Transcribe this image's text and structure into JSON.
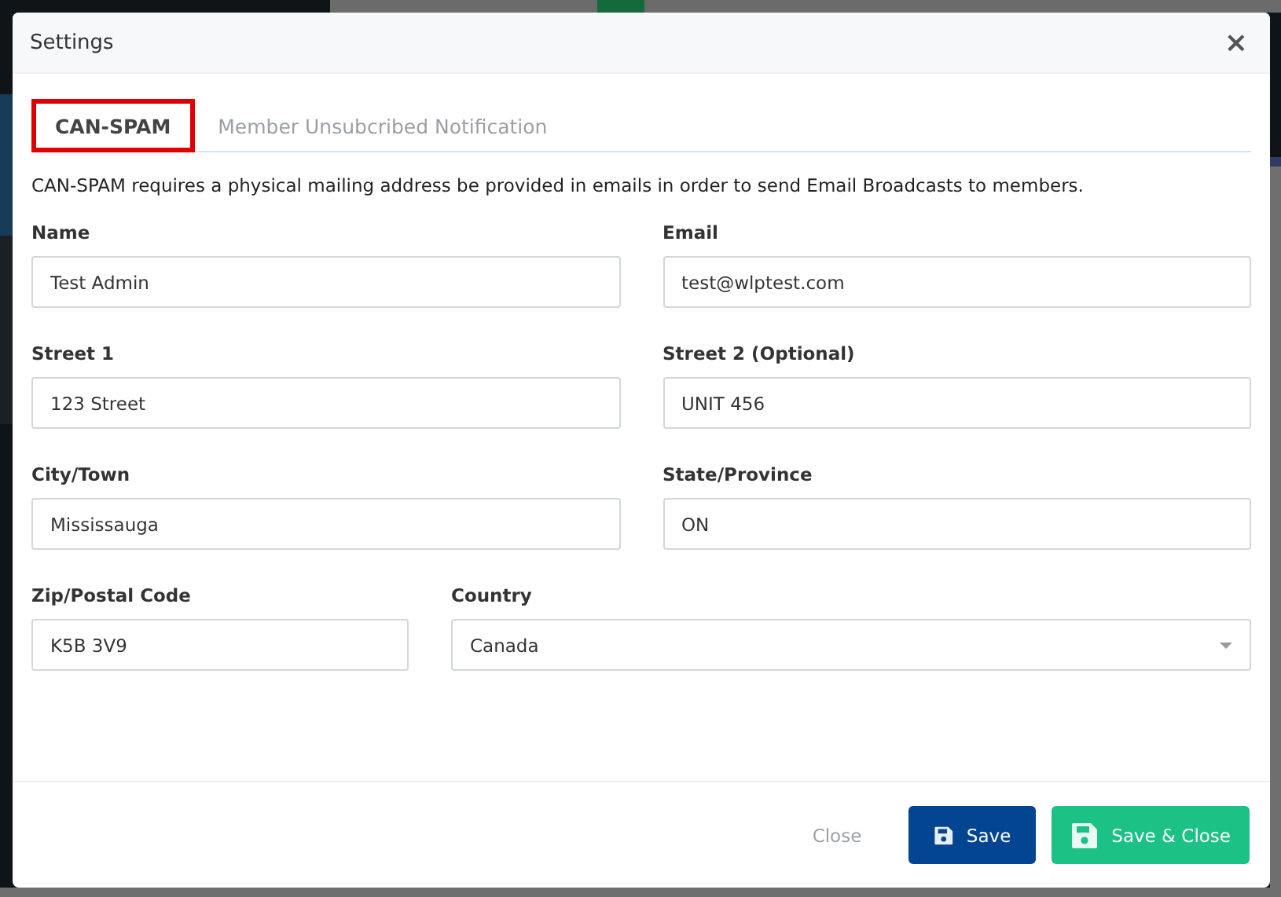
{
  "dialog": {
    "title": "Settings",
    "close": "×"
  },
  "tabs": [
    {
      "label": "CAN-SPAM",
      "selected": true
    },
    {
      "label": "Member Unsubcribed Notification",
      "selected": false
    }
  ],
  "intro": "CAN-SPAM requires a physical mailing address be provided in emails in order to send Email Broadcasts to members.",
  "rows": [
    {
      "fields": [
        {
          "kind": "text",
          "label": "Name",
          "value": "Test Admin"
        },
        {
          "kind": "text",
          "label": "Email",
          "value": "test@wlptest.com"
        }
      ]
    },
    {
      "fields": [
        {
          "kind": "text",
          "label": "Street 1",
          "value": "123 Street"
        },
        {
          "kind": "text",
          "label": "Street 2 (Optional)",
          "value": "UNIT 456"
        }
      ]
    },
    {
      "fields": [
        {
          "kind": "text",
          "label": "City/Town",
          "value": "Mississauga"
        },
        {
          "kind": "text",
          "label": "State/Province",
          "value": "ON"
        }
      ]
    },
    {
      "fields": [
        {
          "kind": "text",
          "label": "Zip/Postal Code",
          "value": "K5B 3V9"
        },
        {
          "kind": "select",
          "label": "Country",
          "value": "Canada"
        }
      ]
    }
  ],
  "footer": {
    "close": "Close",
    "save": "Save",
    "save_close": "Save & Close"
  }
}
